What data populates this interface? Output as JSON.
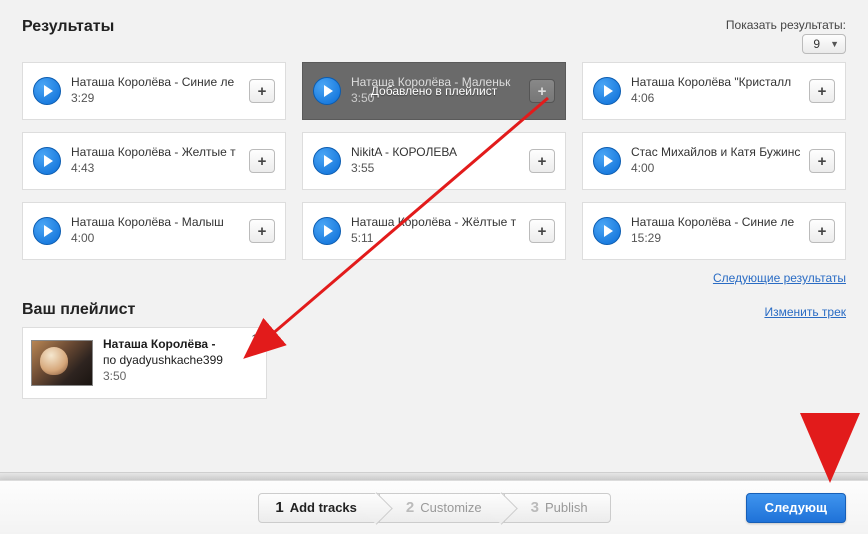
{
  "results": {
    "title": "Результаты",
    "show_label": "Показать результаты:",
    "count": "9",
    "next_link": "Следующие результаты",
    "added_overlay": "Добавлено в плейлист",
    "tracks": [
      {
        "title": "Наташа Королёва - Синие ле",
        "duration": "3:29",
        "added": false
      },
      {
        "title": "Наташа Королёва - Маленьк",
        "duration": "3:50",
        "added": true
      },
      {
        "title": "Наташа Королёва \"Кристалл",
        "duration": "4:06",
        "added": false
      },
      {
        "title": "Наташа Королёва - Желтые т",
        "duration": "4:43",
        "added": false
      },
      {
        "title": "NikitA - КОРОЛЕВА",
        "duration": "3:55",
        "added": false
      },
      {
        "title": "Стас Михайлов и Катя Бужинс",
        "duration": "4:00",
        "added": false
      },
      {
        "title": "Наташа Королёва - Малыш",
        "duration": "4:00",
        "added": false
      },
      {
        "title": "Наташа Королёва - Жёлтые т",
        "duration": "5:11",
        "added": false
      },
      {
        "title": "Наташа Королёва - Синие ле",
        "duration": "15:29",
        "added": false
      }
    ]
  },
  "playlist": {
    "title": "Ваш плейлист",
    "edit_link": "Изменить трек",
    "items": [
      {
        "index": "1",
        "line1": "Наташа Королёва -",
        "line2": "по dyadyushkache399",
        "duration": "3:50"
      }
    ]
  },
  "wizard": {
    "steps": [
      {
        "n": "1",
        "label": "Add tracks",
        "active": true
      },
      {
        "n": "2",
        "label": "Customize",
        "active": false
      },
      {
        "n": "3",
        "label": "Publish",
        "active": false
      }
    ],
    "next": "Следующ"
  },
  "glyphs": {
    "plus": "+"
  }
}
